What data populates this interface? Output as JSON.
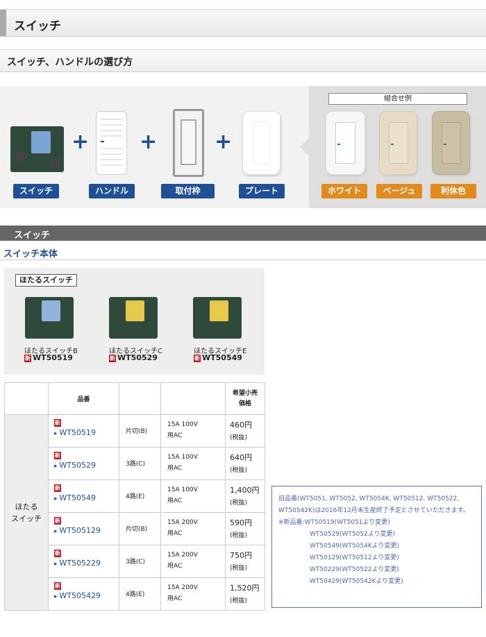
{
  "page_title": "スイッチ",
  "section_howto": {
    "title": "スイッチ、ハンドルの選び方",
    "parts": [
      "スイッチ",
      "ハンドル",
      "取付枠",
      "プレート"
    ],
    "plus": "+",
    "combo_title": "組合せ例",
    "combos": [
      "ホワイト",
      "ベージュ",
      "利休色"
    ]
  },
  "section_switch": {
    "title": "スイッチ",
    "subtitle": "スイッチ本体",
    "group_title": "ほたるスイッチ",
    "new_badge": "新",
    "products": [
      {
        "name": "ほたるスイッチB",
        "code": "WT50519",
        "color": "#8fb5de"
      },
      {
        "name": "ほたるスイッチC",
        "code": "WT50529",
        "color": "#e6c84a"
      },
      {
        "name": "ほたるスイッチE",
        "code": "WT50549",
        "color": "#e6c84a"
      }
    ]
  },
  "table": {
    "headers": {
      "code": "品番",
      "price_line1": "希望小売",
      "price_line2": "価格"
    },
    "group_line1": "ほたる",
    "group_line2": "スイッチ",
    "rows": [
      {
        "new": "新",
        "code": "WT50519",
        "type": "片切(B)",
        "spec1": "15A 100V",
        "spec2": "用AC",
        "price": "460円",
        "tax": "(税抜)"
      },
      {
        "new": "新",
        "code": "WT50529",
        "type": "3路(C)",
        "spec1": "15A 100V",
        "spec2": "用AC",
        "price": "640円",
        "tax": "(税抜)"
      },
      {
        "new": "新",
        "code": "WT50549",
        "type": "4路(E)",
        "spec1": "15A 100V",
        "spec2": "用AC",
        "price": "1,400円",
        "tax": "(税抜)"
      },
      {
        "new": "新",
        "code": "WT505129",
        "type": "片切(B)",
        "spec1": "15A 200V",
        "spec2": "用AC",
        "price": "590円",
        "tax": "(税抜)"
      },
      {
        "new": "新",
        "code": "WT505229",
        "type": "3路(C)",
        "spec1": "15A 200V",
        "spec2": "用AC",
        "price": "750円",
        "tax": "(税抜)"
      },
      {
        "new": "新",
        "code": "WT505429",
        "type": "4路(E)",
        "spec1": "15A 200V",
        "spec2": "用AC",
        "price": "1,520円",
        "tax": "(税抜)"
      }
    ]
  },
  "note": {
    "line1": "旧品番(WT5051, WT5052, WT5054K, WT50512, WT50522,",
    "line2": "WT50542K)は2016年12月末生産終了予定とさせていただきます。",
    "line3": "※新品番:WT50519(WT5051より変更)",
    "items": [
      "WT50529(WT5052より変更)",
      "WT50549(WT5054Kより変更)",
      "WT50129(WT50512より変更)",
      "WT50229(WT50522より変更)",
      "WT50429(WT50542Kより変更)"
    ]
  },
  "colors": {
    "navy": "#1f4f96",
    "orange": "#e08b1c",
    "new_red": "#c9171e",
    "white_plate": "#f4f4f4",
    "beige_plate": "#e6dcc6",
    "rikyu_plate": "#c8bda2"
  }
}
